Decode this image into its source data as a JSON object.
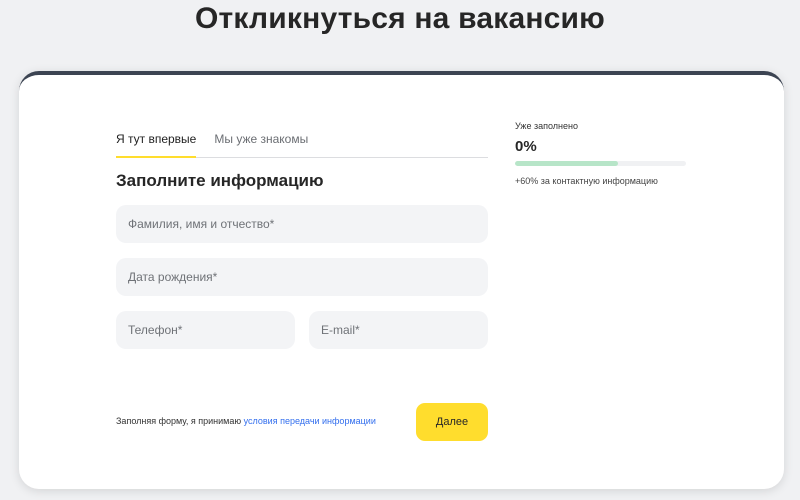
{
  "page": {
    "title": "Откликнуться на вакансию"
  },
  "tabs": [
    {
      "label": "Я тут впервые",
      "active": true
    },
    {
      "label": "Мы уже знакомы",
      "active": false
    }
  ],
  "form": {
    "heading": "Заполните информацию",
    "fields": {
      "full_name": {
        "placeholder": "Фамилия, имя и отчество*",
        "value": ""
      },
      "birth_date": {
        "placeholder": "Дата рождения*",
        "value": ""
      },
      "phone": {
        "placeholder": "Телефон*",
        "value": ""
      },
      "email": {
        "placeholder": "E-mail*",
        "value": ""
      }
    },
    "consent": {
      "text": "Заполняя форму, я принимаю ",
      "link": "условия передачи информации"
    },
    "submit_label": "Далее"
  },
  "progress": {
    "label": "Уже заполнено",
    "value_text": "0%",
    "segment_fraction": 0.6,
    "note": "+60% за контактную информацию"
  },
  "colors": {
    "accent": "#ffdd2d",
    "link": "#336fee",
    "progress_fill": "#b7e5c8",
    "card_top_border": "#3c4452"
  }
}
